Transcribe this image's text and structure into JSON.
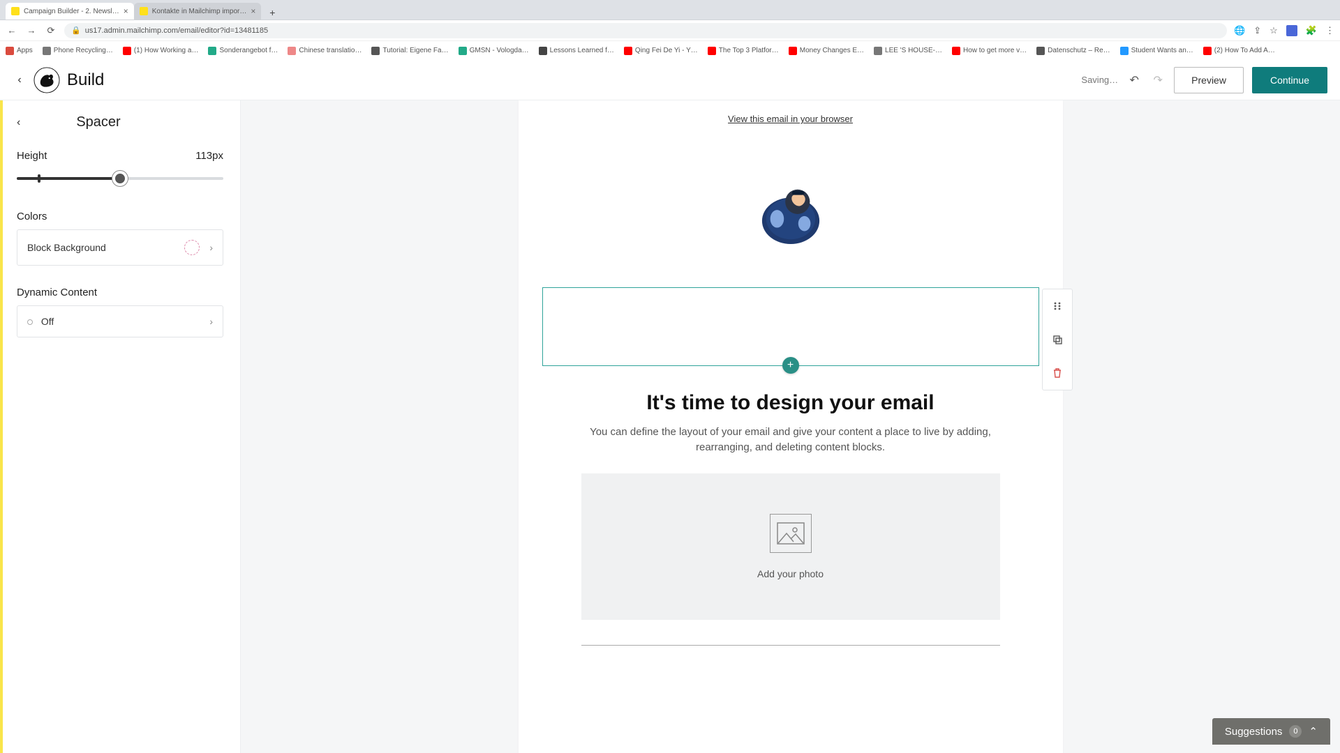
{
  "browser": {
    "tabs": [
      {
        "title": "Campaign Builder - 2. Newsl…",
        "active": true
      },
      {
        "title": "Kontakte in Mailchimp impor…",
        "active": false
      }
    ],
    "url": "us17.admin.mailchimp.com/email/editor?id=13481185",
    "bookmarks": [
      {
        "label": "Apps",
        "color": "#da4b3e"
      },
      {
        "label": "Phone Recycling…",
        "color": "#777"
      },
      {
        "label": "(1) How Working a…",
        "color": "#ff0000"
      },
      {
        "label": "Sonderangebot f…",
        "color": "#2a8"
      },
      {
        "label": "Chinese translatio…",
        "color": "#e88"
      },
      {
        "label": "Tutorial: Eigene Fa…",
        "color": "#555"
      },
      {
        "label": "GMSN - Vologda…",
        "color": "#2a8"
      },
      {
        "label": "Lessons Learned f…",
        "color": "#444"
      },
      {
        "label": "Qing Fei De Yi - Y…",
        "color": "#ff0000"
      },
      {
        "label": "The Top 3 Platfor…",
        "color": "#ff0000"
      },
      {
        "label": "Money Changes E…",
        "color": "#ff0000"
      },
      {
        "label": "LEE 'S HOUSE-…",
        "color": "#777"
      },
      {
        "label": "How to get more v…",
        "color": "#ff0000"
      },
      {
        "label": "Datenschutz – Re…",
        "color": "#555"
      },
      {
        "label": "Student Wants an…",
        "color": "#29f"
      },
      {
        "label": "(2) How To Add A…",
        "color": "#ff0000"
      }
    ]
  },
  "header": {
    "title": "Build",
    "status": "Saving…",
    "preview": "Preview",
    "continue": "Continue"
  },
  "sidebar": {
    "title": "Spacer",
    "height_label": "Height",
    "height_value": "113px",
    "slider_percent": 50,
    "colors_title": "Colors",
    "block_background": "Block Background",
    "dynamic_title": "Dynamic Content",
    "dynamic_value": "Off"
  },
  "email": {
    "view_online": "View this email in your browser",
    "hero_title": "It's time to design your email",
    "hero_sub": "You can define the layout of your email and give your content a place to live by adding, rearranging, and deleting content blocks.",
    "add_photo": "Add your photo"
  },
  "suggestions": {
    "label": "Suggestions",
    "count": "0"
  }
}
